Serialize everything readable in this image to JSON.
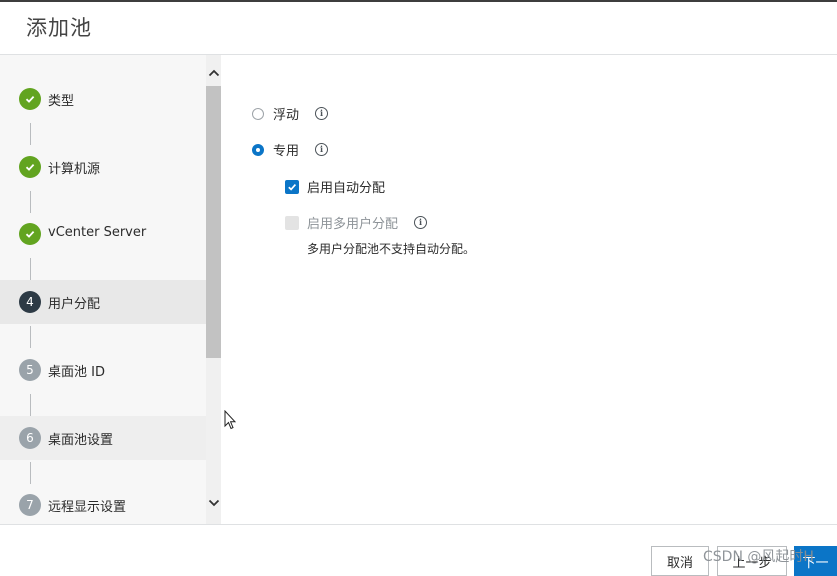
{
  "dialog": {
    "title": "添加池"
  },
  "sidebar": {
    "steps": [
      {
        "marker": "",
        "label": "类型",
        "state": "done"
      },
      {
        "marker": "",
        "label": "计算机源",
        "state": "done"
      },
      {
        "marker": "",
        "label": "vCenter Server",
        "state": "done"
      },
      {
        "marker": "4",
        "label": "用户分配",
        "state": "current"
      },
      {
        "marker": "5",
        "label": "桌面池 ID",
        "state": "todo"
      },
      {
        "marker": "6",
        "label": "桌面池设置",
        "state": "todo"
      },
      {
        "marker": "7",
        "label": "远程显示设置",
        "state": "todo"
      }
    ]
  },
  "main": {
    "floating": {
      "label": "浮动",
      "selected": false
    },
    "dedicated": {
      "label": "专用",
      "selected": true
    },
    "auto_assign": {
      "label": "启用自动分配",
      "checked": true
    },
    "multi_user": {
      "label": "启用多用户分配",
      "checked": false,
      "disabled": true
    },
    "note": "多用户分配池不支持自动分配。"
  },
  "footer": {
    "cancel_label": "取消",
    "back_label": "上一步",
    "next_label": "下一"
  },
  "watermark": "CSDN @风起时H",
  "colors": {
    "done": "#62a420",
    "current": "#2d3a45",
    "todo": "#9aa3aa",
    "accent": "#0b75c7"
  }
}
